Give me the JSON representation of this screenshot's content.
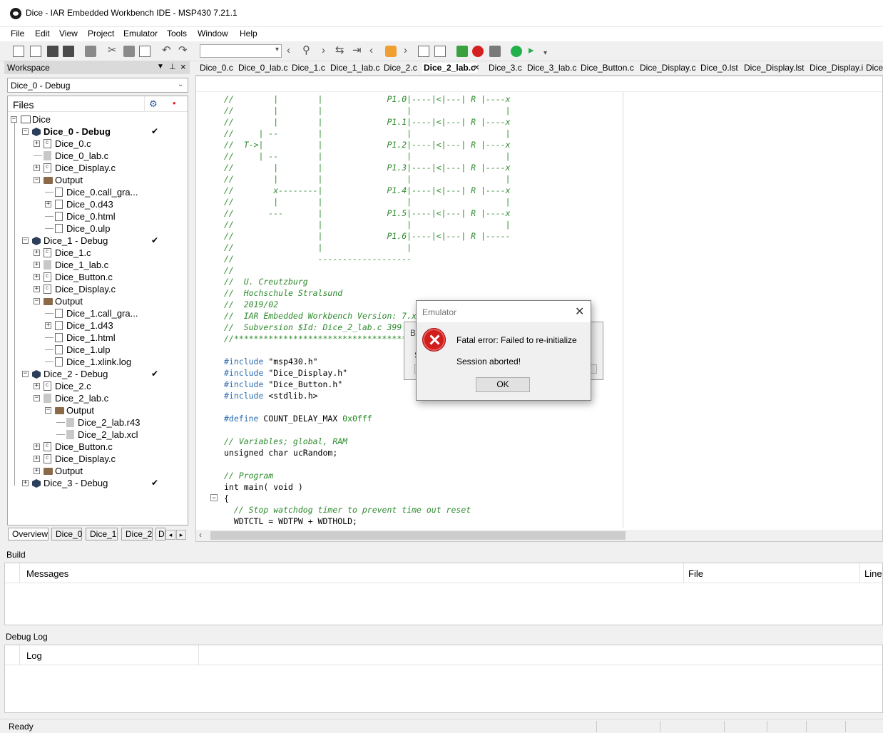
{
  "window": {
    "title": "Dice - IAR Embedded Workbench IDE - MSP430 7.21.1"
  },
  "menu": [
    "File",
    "Edit",
    "View",
    "Project",
    "Emulator",
    "Tools",
    "Window",
    "Help"
  ],
  "workspace": {
    "title": "Workspace",
    "config": "Dice_0 - Debug",
    "files_label": "Files",
    "tree": [
      {
        "label": "Dice",
        "bold": false
      },
      {
        "label": "Dice_0 - Debug",
        "bold": true,
        "check": "✔"
      },
      {
        "label": "Dice_0.c"
      },
      {
        "label": "Dice_0_lab.c"
      },
      {
        "label": "Dice_Display.c"
      },
      {
        "label": "Output"
      },
      {
        "label": "Dice_0.call_gra..."
      },
      {
        "label": "Dice_0.d43"
      },
      {
        "label": "Dice_0.html"
      },
      {
        "label": "Dice_0.ulp"
      },
      {
        "label": "Dice_1 - Debug",
        "check": "✔"
      },
      {
        "label": "Dice_1.c"
      },
      {
        "label": "Dice_1_lab.c"
      },
      {
        "label": "Dice_Button.c"
      },
      {
        "label": "Dice_Display.c"
      },
      {
        "label": "Output"
      },
      {
        "label": "Dice_1.call_gra..."
      },
      {
        "label": "Dice_1.d43"
      },
      {
        "label": "Dice_1.html"
      },
      {
        "label": "Dice_1.ulp"
      },
      {
        "label": "Dice_1.xlink.log"
      },
      {
        "label": "Dice_2 - Debug",
        "check": "✔"
      },
      {
        "label": "Dice_2.c"
      },
      {
        "label": "Dice_2_lab.c"
      },
      {
        "label": "Output"
      },
      {
        "label": "Dice_2_lab.r43"
      },
      {
        "label": "Dice_2_lab.xcl"
      },
      {
        "label": "Dice_Button.c"
      },
      {
        "label": "Dice_Display.c"
      },
      {
        "label": "Output"
      },
      {
        "label": "Dice_3 - Debug",
        "check": "✔"
      }
    ],
    "bottom_tabs": [
      "Overview",
      "Dice_0",
      "Dice_1",
      "Dice_2",
      "D"
    ]
  },
  "editor": {
    "tabs": [
      "Dice_0.c",
      "Dice_0_lab.c",
      "Dice_1.c",
      "Dice_1_lab.c",
      "Dice_2.c",
      "Dice_2_lab.c",
      "×",
      "Dice_3.c",
      "Dice_3_lab.c",
      "Dice_Button.c",
      "Dice_Display.c",
      "Dice_0.lst",
      "Dice_Display.lst",
      "Dice_Display.i",
      "Dice"
    ],
    "active_tab": "Dice_2_lab.c",
    "code": [
      {
        "t": "cm",
        "text": "//        |        |             P1.0|----|<|---| R |----x"
      },
      {
        "t": "cm",
        "text": "//        |        |                 |                   |"
      },
      {
        "t": "cm",
        "text": "//        |        |             P1.1|----|<|---| R |----x"
      },
      {
        "t": "cm",
        "text": "//     | --        |                 |                   |"
      },
      {
        "t": "cm",
        "text": "//  T->|           |             P1.2|----|<|---| R |----x"
      },
      {
        "t": "cm",
        "text": "//     | --        |                 |                   |"
      },
      {
        "t": "cm",
        "text": "//        |        |             P1.3|----|<|---| R |----x"
      },
      {
        "t": "cm",
        "text": "//        |        |                 |                   |"
      },
      {
        "t": "cm",
        "text": "//        x--------|             P1.4|----|<|---| R |----x"
      },
      {
        "t": "cm",
        "text": "//        |        |                 |                   |"
      },
      {
        "t": "cm",
        "text": "//       ---       |             P1.5|----|<|---| R |----x"
      },
      {
        "t": "cm",
        "text": "//                 |                 |                   |"
      },
      {
        "t": "cm",
        "text": "//                 |             P1.6|----|<|---| R |-----"
      },
      {
        "t": "cm",
        "text": "//                 |                 |"
      },
      {
        "t": "cm",
        "text": "//                 -------------------"
      },
      {
        "t": "cm",
        "text": "//"
      },
      {
        "t": "cm",
        "text": "//  U. Creutzburg"
      },
      {
        "t": "cm",
        "text": "//  Hochschule Stralsund"
      },
      {
        "t": "cm",
        "text": "//  2019/02"
      },
      {
        "t": "cm",
        "text": "//  IAR Embedded Workbench Version: 7.x"
      },
      {
        "t": "cm",
        "text": "//  Subversion $Id: Dice_2_lab.c 399"
      },
      {
        "t": "cm",
        "text": "//***************************************************************************"
      },
      {
        "t": "blank",
        "text": ""
      },
      {
        "t": "inc",
        "kw": "#include",
        "rest": " \"msp430.h\""
      },
      {
        "t": "inc",
        "kw": "#include",
        "rest": " \"Dice_Display.h\""
      },
      {
        "t": "inc",
        "kw": "#include",
        "rest": " \"Dice_Button.h\""
      },
      {
        "t": "inc",
        "kw": "#include",
        "rest": " <stdlib.h>"
      },
      {
        "t": "blank",
        "text": ""
      },
      {
        "t": "def",
        "kw": "#define",
        "rest": " COUNT_DELAY_MAX ",
        "num": "0x0fff"
      },
      {
        "t": "blank",
        "text": ""
      },
      {
        "t": "cm",
        "text": "// Variables; global, RAM"
      },
      {
        "t": "code",
        "text": "unsigned char ucRandom;"
      },
      {
        "t": "blank",
        "text": ""
      },
      {
        "t": "cm",
        "text": "// Program"
      },
      {
        "t": "code",
        "text": "int main( void )"
      },
      {
        "t": "code",
        "text": "{"
      },
      {
        "t": "cm",
        "text": "  // Stop watchdog timer to prevent time out reset"
      },
      {
        "t": "code",
        "text": "  WDTCTL = WDTPW + WDTHOLD;"
      }
    ]
  },
  "build": {
    "title": "Build",
    "columns": [
      "Messages",
      "File",
      "Line"
    ]
  },
  "debug_log": {
    "title": "Debug Log",
    "columns": [
      "Log"
    ]
  },
  "status": {
    "text": "Ready"
  },
  "background_dialog": {
    "title_fragment": "B",
    "text_fragment": "S"
  },
  "dialog": {
    "title": "Emulator",
    "message1": "Fatal error: Failed to re-initialize",
    "message2": "Session aborted!",
    "ok_label": "OK",
    "icon": "error-icon"
  }
}
